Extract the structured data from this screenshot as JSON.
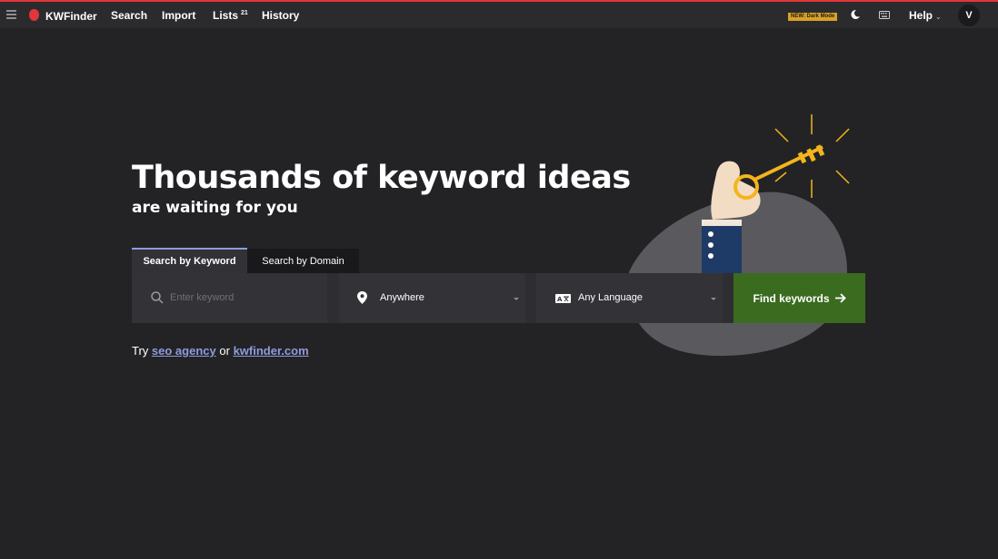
{
  "header": {
    "app_name": "KWFinder",
    "nav": [
      {
        "label": "Search"
      },
      {
        "label": "Import"
      },
      {
        "label": "Lists",
        "count": "21"
      },
      {
        "label": "History"
      }
    ],
    "new_badge": "NEW: Dark Mode",
    "help_label": "Help",
    "avatar_initial": "V",
    "accent_color": "#e2363a"
  },
  "hero": {
    "title": "Thousands of keyword ideas",
    "subtitle": "are waiting for you"
  },
  "tabs": [
    {
      "label": "Search by Keyword",
      "active": true
    },
    {
      "label": "Search by Domain",
      "active": false
    }
  ],
  "search": {
    "keyword_placeholder": "Enter keyword",
    "keyword_value": "",
    "location_value": "Anywhere",
    "language_value": "Any Language",
    "find_button": "Find keywords",
    "button_color": "#3a6b1f"
  },
  "try_line": {
    "prefix": "Try",
    "link1": "seo agency",
    "middle": "or",
    "link2": "kwfinder.com"
  },
  "icons": {
    "menu": "hamburger-icon",
    "logo": "kwfinder-logo-icon",
    "moon": "moon-icon",
    "keyboard": "keyboard-icon",
    "search": "search-icon",
    "location": "location-pin-icon",
    "language": "translate-icon",
    "arrow": "arrow-right-icon"
  }
}
